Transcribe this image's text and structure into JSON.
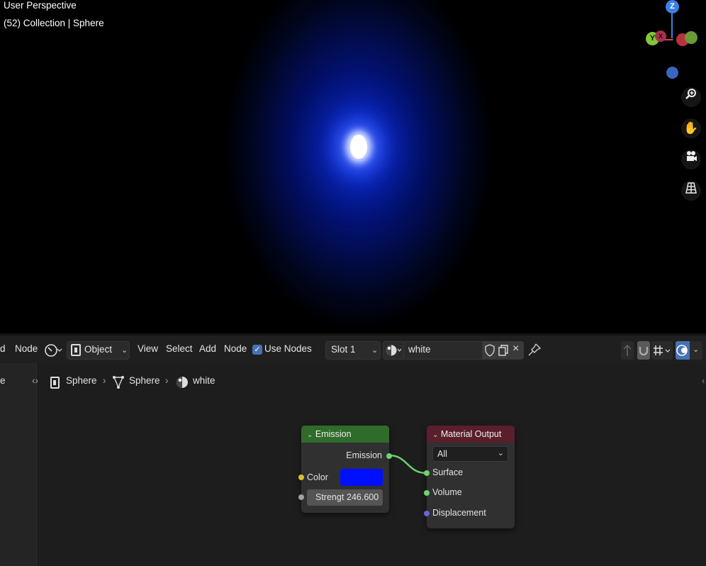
{
  "viewport": {
    "title": "User Perspective",
    "collection_line": "(52) Collection | Sphere",
    "gizmo": {
      "z": "Z",
      "y": "Y",
      "x": "X"
    }
  },
  "header": {
    "cut_label": "d",
    "node_menu_left": "Node",
    "mode": "Object",
    "menus": [
      "View",
      "Select",
      "Add",
      "Node"
    ],
    "use_nodes": "Use Nodes",
    "slot": "Slot 1",
    "material": "white"
  },
  "editor": {
    "side_cut": "e",
    "breadcrumbs": [
      "Sphere",
      "Sphere",
      "white"
    ]
  },
  "nodes": {
    "emission": {
      "title": "Emission",
      "output": "Emission",
      "color_label": "Color",
      "color_value": "#0010ff",
      "strength_label": "Strengt",
      "strength_value": "246.600"
    },
    "output": {
      "title": "Material Output",
      "target": "All",
      "inputs": [
        "Surface",
        "Volume",
        "Displacement"
      ]
    }
  },
  "colors": {
    "emission_header": "#2f6b2a",
    "output_header": "#5a1f2a",
    "shader_socket": "#6fd36f",
    "color_socket": "#d8c22c",
    "float_socket": "#a1a1a1",
    "vector_socket": "#6a63d8",
    "accent": "#4772b3"
  },
  "icons": [
    "gizmo-axes",
    "zoom-icon",
    "hand-pan-icon",
    "camera-icon",
    "grid-perspective-icon",
    "editor-type-icon",
    "object-icon",
    "mesh-icon",
    "material-sphere-icon",
    "shield-fake-user-icon",
    "duplicate-icon",
    "close-icon",
    "pin-icon",
    "parent-arrow-icon",
    "magnet-snap-icon",
    "snap-grid-icon",
    "overlay-icon"
  ]
}
